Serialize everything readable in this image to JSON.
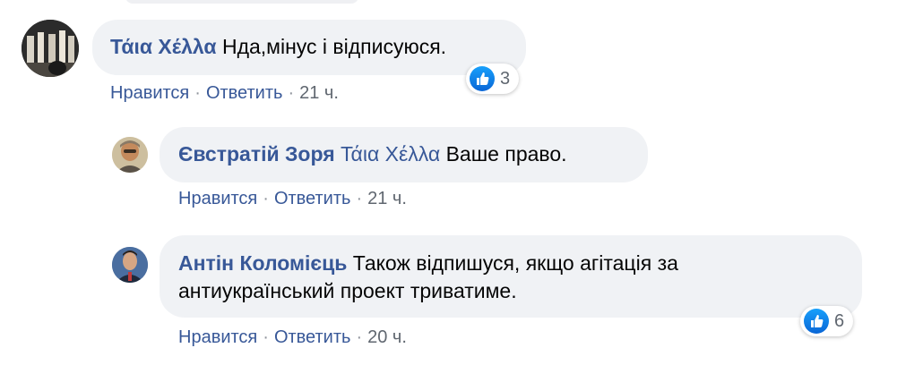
{
  "colors": {
    "link": "#385898",
    "bubble": "#f0f2f5",
    "like": "#1877f2"
  },
  "comments": [
    {
      "author": "Τάια Χέλλα",
      "text": "Нда,мінус і відписуюся.",
      "actions": {
        "like": "Нравится",
        "reply": "Ответить",
        "time": "21 ч."
      },
      "reactions": {
        "icon": "like-icon",
        "count": "3"
      }
    },
    {
      "author": "Євстратій Зоря",
      "mention": "Τάια Χέλλα",
      "text": "Ваше право.",
      "actions": {
        "like": "Нравится",
        "reply": "Ответить",
        "time": "21 ч."
      }
    },
    {
      "author": "Антін Коломієць",
      "text_line1": "Також відпишуся, якщо агітація за",
      "text_line2": "антиукраїнський проект триватиме.",
      "actions": {
        "like": "Нравится",
        "reply": "Ответить",
        "time": "20 ч."
      },
      "reactions": {
        "icon": "like-icon",
        "count": "6"
      }
    }
  ]
}
